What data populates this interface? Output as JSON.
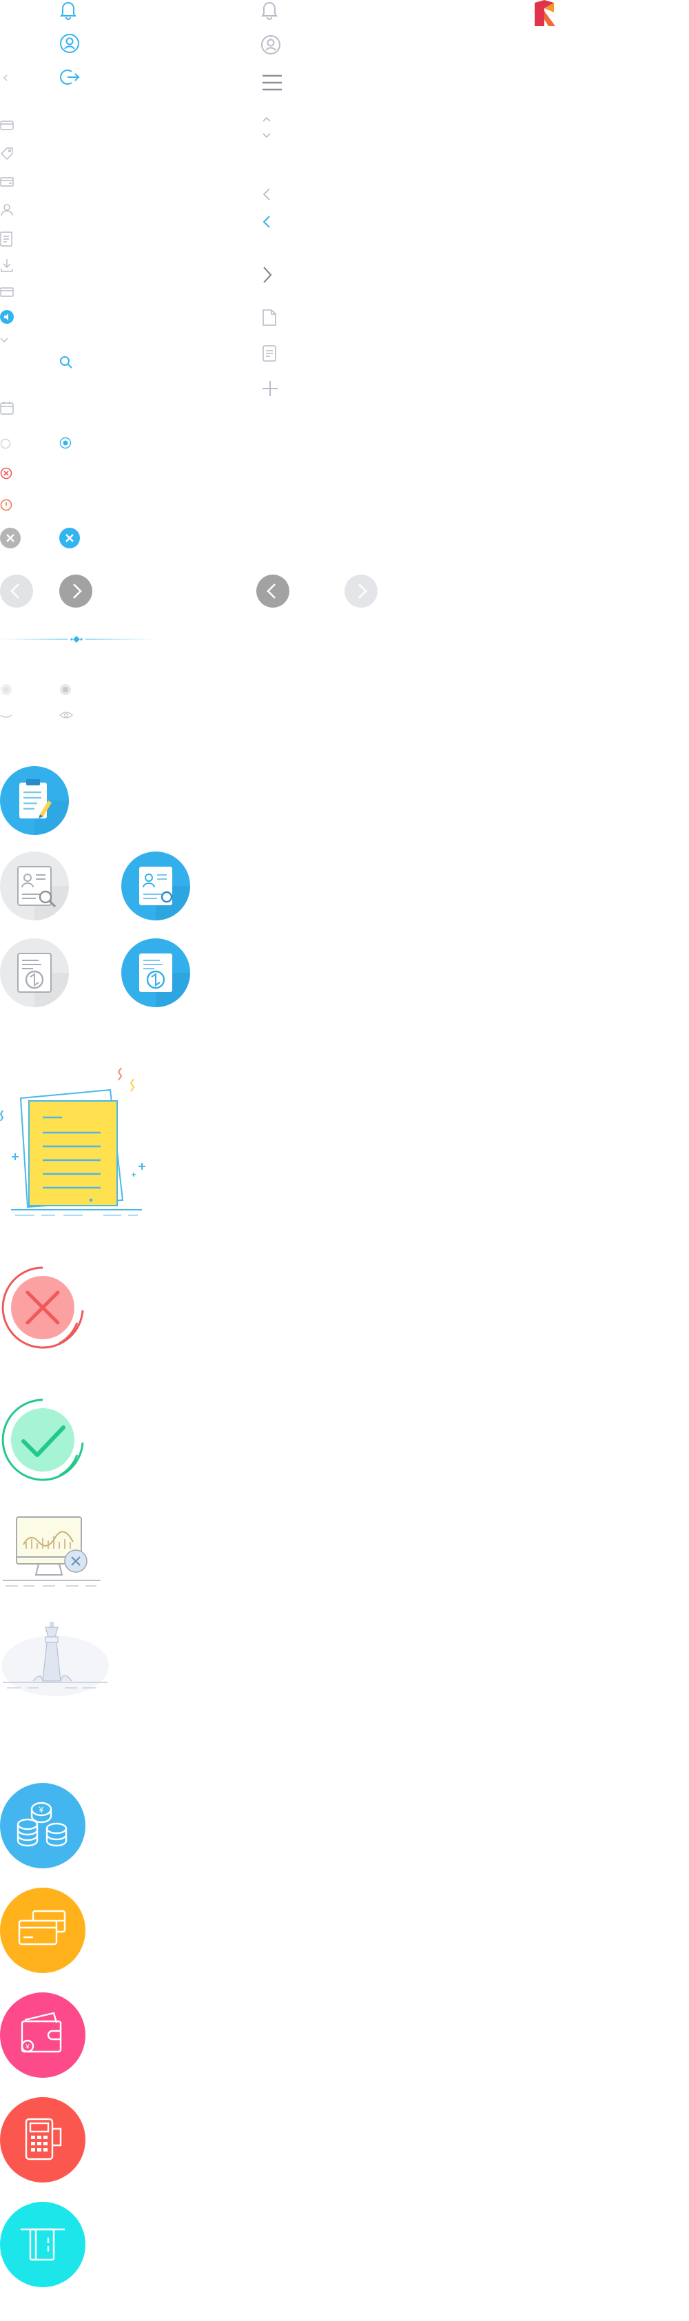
{
  "colors": {
    "accent_blue": "#33b4f0",
    "icon_grey": "#b8bcc6",
    "light_grey": "#d9dbe0",
    "error_red": "#f0595a",
    "success_green": "#23c98a",
    "notice_yellow": "#ffe14f",
    "coins_blue": "#43b6f0",
    "card_orange": "#ffb21c",
    "wallet_pink": "#fc4a8a",
    "pos_red": "#fb574e",
    "atm_cyan": "#1ce6ea",
    "logo_red": "#e0334a",
    "logo_orange": "#f8962e"
  },
  "icons": [
    "bell-icon",
    "user-circle-icon",
    "logout-icon",
    "menu-icon",
    "chevron-updown-icon",
    "chevron-left-icon",
    "chevron-right-icon",
    "document-icon",
    "plus-icon",
    "search-icon",
    "calendar-icon",
    "radio-icon",
    "error-circle-icon",
    "info-circle-icon",
    "close-icon",
    "prev-arrow-button",
    "next-arrow-button",
    "dot-icon",
    "eye-icon",
    "clipboard-edit-icon",
    "resume-search-icon",
    "resume-edit-icon",
    "resume-refresh-icon",
    "notes-illustration",
    "failure-illustration",
    "success-illustration",
    "monitor-error-illustration",
    "lighthouse-illustration",
    "coins-icon",
    "credit-cards-icon",
    "wallet-icon",
    "pos-terminal-icon",
    "atm-card-icon",
    "brand-logo"
  ]
}
